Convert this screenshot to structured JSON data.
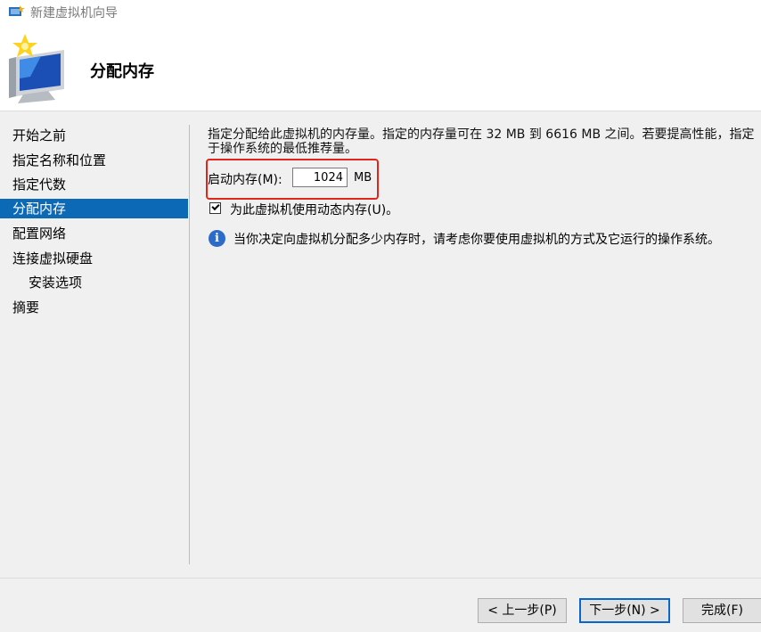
{
  "window": {
    "title": "新建虚拟机向导"
  },
  "header": {
    "title": "分配内存"
  },
  "nav": {
    "items": [
      {
        "label": "开始之前"
      },
      {
        "label": "指定名称和位置"
      },
      {
        "label": "指定代数"
      },
      {
        "label": "分配内存",
        "active": true
      },
      {
        "label": "配置网络"
      },
      {
        "label": "连接虚拟硬盘"
      },
      {
        "label": "安装选项",
        "sub": true
      },
      {
        "label": "摘要"
      }
    ]
  },
  "main": {
    "description_line1": "指定分配给此虚拟机的内存量。指定的内存量可在 32 MB 到 6616 MB 之间。若要提高性能，指定",
    "description_line2": "于操作系统的最低推荐量。",
    "startup_memory": {
      "label": "启动内存(M):",
      "value": "1024",
      "unit": "MB"
    },
    "dynamic_memory": {
      "label": "为此虚拟机使用动态内存(U)。",
      "checked": true
    },
    "info": {
      "icon": "info-icon",
      "text": "当你决定向虚拟机分配多少内存时，请考虑你要使用虚拟机的方式及它运行的操作系统。"
    }
  },
  "buttons": {
    "back": "< 上一步(P)",
    "next": "下一步(N) >",
    "finish": "完成(F)"
  },
  "colors": {
    "accent": "#0c69b6",
    "highlight": "#e0251d",
    "info": "#2d6bc9"
  }
}
